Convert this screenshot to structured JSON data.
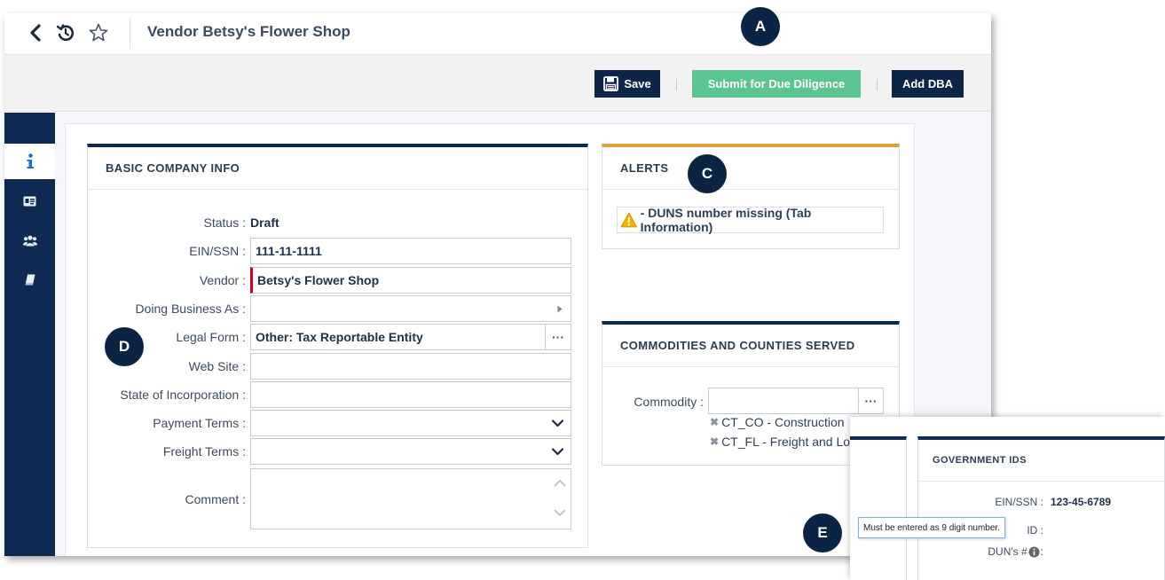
{
  "header": {
    "title": "Vendor Betsy's Flower Shop",
    "icons": [
      "back-icon",
      "history-icon",
      "star-icon"
    ]
  },
  "toolbar": {
    "save_label": "Save",
    "submit_label": "Submit for Due Diligence",
    "add_dba_label": "Add DBA"
  },
  "sidebar": {
    "items": [
      {
        "icon": "info-icon",
        "active": true
      },
      {
        "icon": "id-card-icon",
        "active": false
      },
      {
        "icon": "users-icon",
        "active": false
      },
      {
        "icon": "book-icon",
        "active": false
      }
    ]
  },
  "basic_info": {
    "heading": "BASIC COMPANY INFO",
    "status_label": "Status :",
    "status_value": "Draft",
    "ein_label": "EIN/SSN :",
    "ein_value": "111-11-1111",
    "vendor_label": "Vendor :",
    "vendor_value": "Betsy's Flower Shop",
    "dba_label": "Doing Business As :",
    "dba_value": "",
    "legal_form_label": "Legal Form :",
    "legal_form_value": "Other: Tax Reportable Entity",
    "web_site_label": "Web Site :",
    "web_site_value": "",
    "state_label": "State of Incorporation :",
    "state_value": "",
    "payment_terms_label": "Payment Terms :",
    "payment_terms_value": "",
    "freight_terms_label": "Freight Terms :",
    "freight_terms_value": "",
    "comment_label": "Comment :",
    "comment_value": "",
    "ellipsis": "···"
  },
  "alerts": {
    "heading": "ALERTS",
    "items": [
      "- DUNS number missing (Tab Information)"
    ],
    "accent": "#e0a040"
  },
  "commodities": {
    "heading": "COMMODITIES AND COUNTIES SERVED",
    "commodity_label": "Commodity :",
    "commodity_value": "",
    "ellipsis": "···",
    "tags": [
      "CT_CO - Construction",
      "CT_FL - Freight and Log"
    ]
  },
  "government_ids": {
    "heading": "GOVERNMENT IDS",
    "ein_label": "EIN/SSN :",
    "ein_value": "123-45-6789",
    "id_label_fragment": "ID :",
    "duns_label": "DUN's #",
    "duns_colon": ":",
    "tooltip": "Must be entered as 9 digit number."
  },
  "callouts": [
    "A",
    "C",
    "D",
    "E"
  ],
  "colors": {
    "navy": "#0e2a52",
    "green": "#5bc592",
    "alert_orange": "#e0a040",
    "required_red": "#d0021b"
  }
}
